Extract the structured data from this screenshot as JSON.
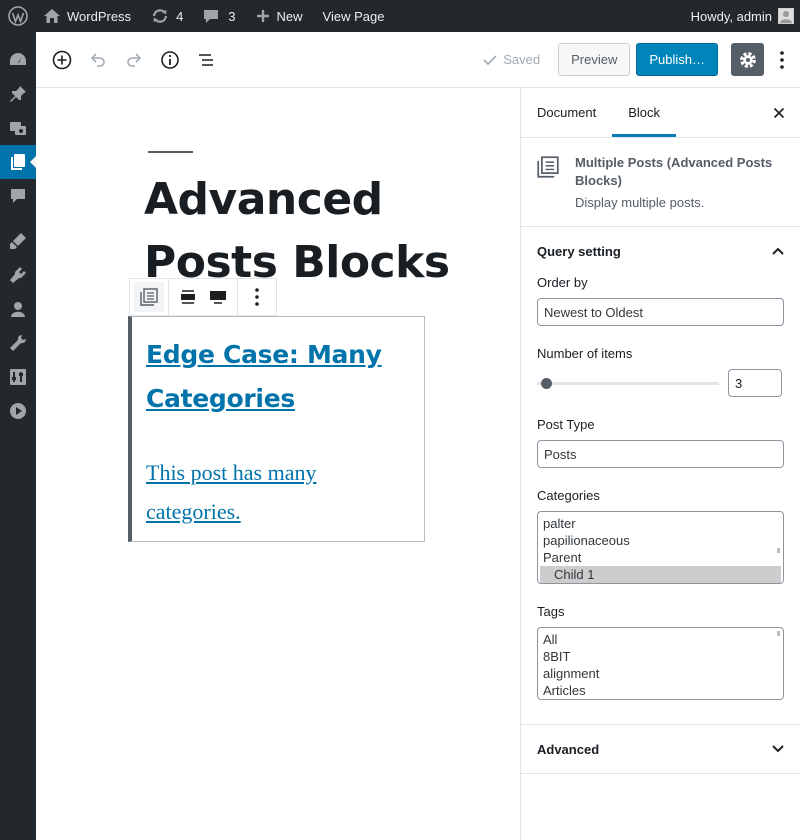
{
  "admin_bar": {
    "site_name": "WordPress",
    "updates_count": "4",
    "comments_count": "3",
    "new_label": "New",
    "view_page_label": "View Page",
    "greeting": "Howdy, admin"
  },
  "admin_menu": {
    "items": [
      "dashboard",
      "posts",
      "media",
      "pages",
      "comments",
      "appearance",
      "plugins",
      "users",
      "tools",
      "settings",
      "media-player"
    ],
    "active": "pages"
  },
  "toolbar": {
    "saved_label": "Saved",
    "preview_label": "Preview",
    "publish_label": "Publish…"
  },
  "post": {
    "title": "Advanced Posts Blocks"
  },
  "block": {
    "post_title": "Edge Case: Many Categories",
    "post_excerpt": "This post has many categories."
  },
  "sidebar": {
    "tabs": [
      "Document",
      "Block"
    ],
    "active_tab": "Block",
    "block_card": {
      "title": "Multiple Posts (Advanced Posts Blocks)",
      "description": "Display multiple posts."
    },
    "query_panel": {
      "title": "Query setting",
      "order_by_label": "Order by",
      "order_by_value": "Newest to Oldest",
      "number_label": "Number of items",
      "number_value": "3",
      "number_fraction": 0.05,
      "post_type_label": "Post Type",
      "post_type_value": "Posts",
      "categories_label": "Categories",
      "categories": [
        "palter",
        "papilionaceous",
        "Parent",
        "Child 1"
      ],
      "selected_category": "Child 1",
      "tags_label": "Tags",
      "tags": [
        "All",
        "8BIT",
        "alignment",
        "Articles"
      ]
    },
    "advanced_panel": {
      "title": "Advanced"
    }
  },
  "colors": {
    "admin_bg": "#23282d",
    "accent": "#0073aa",
    "publish": "#0085ba"
  }
}
